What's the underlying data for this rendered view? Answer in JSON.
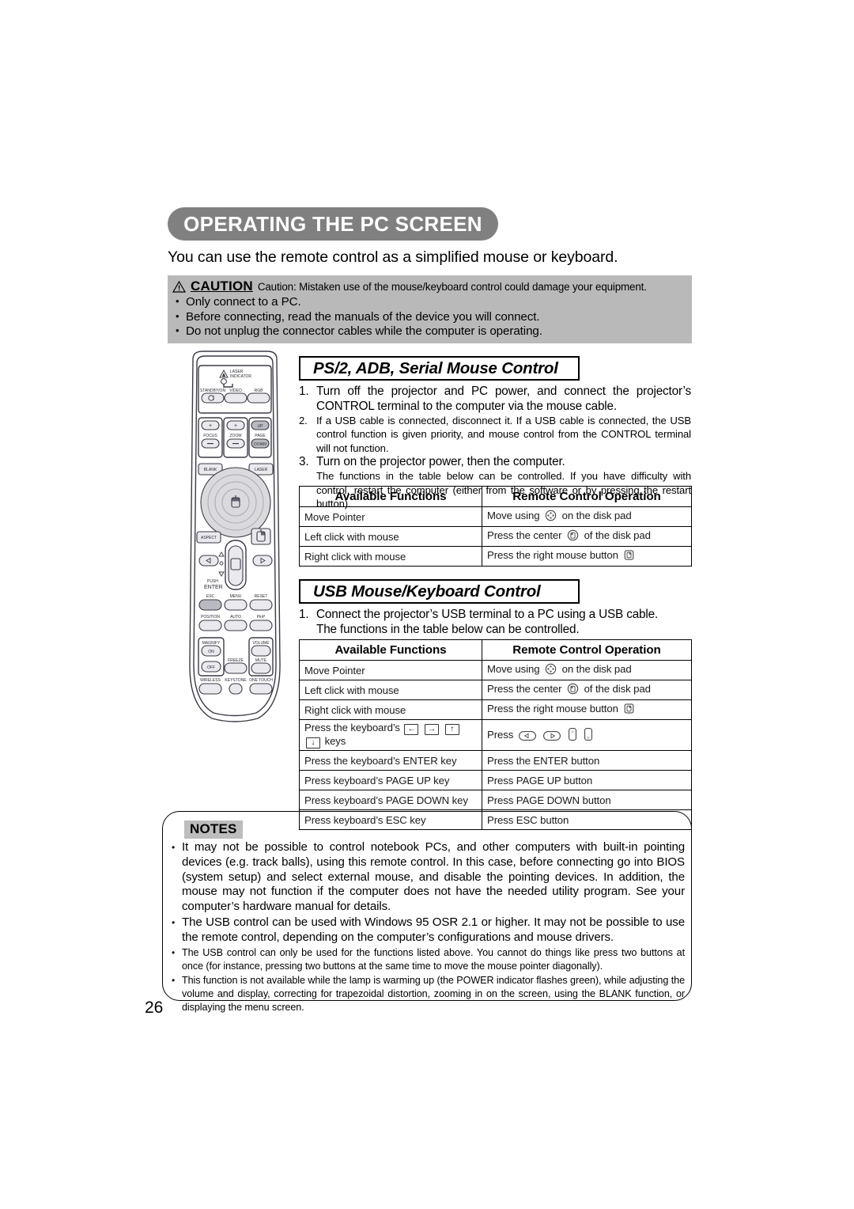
{
  "page": {
    "title": "OPERATING THE PC SCREEN",
    "intro": "You can use the remote control as a simplified mouse or keyboard.",
    "number": "26"
  },
  "caution": {
    "icon": "warning-triangle-icon",
    "word": "CAUTION",
    "text": "Caution: Mistaken use of the mouse/keyboard control could damage your equipment.",
    "bullets": [
      "Only connect to a PC.",
      "Before connecting, read the manuals of the device you will connect.",
      "Do not unplug the connector cables while the computer is operating."
    ]
  },
  "remote": {
    "caption": "remote-control-illustration",
    "buttons": [
      "LASER INDICATOR",
      "STANDBY/ON",
      "VIDEO",
      "RGB",
      "FOCUS",
      "ZOOM",
      "PAGE UP",
      "PAGE DOWN",
      "BLANK",
      "LASER",
      "ASPECT",
      "PUSH ENTER",
      "ESC",
      "MENU",
      "RESET",
      "POSITION",
      "AUTO",
      "PinP",
      "MAGNIFY ON",
      "MAGNIFY OFF",
      "FREEZE",
      "VOLUME",
      "MUTE",
      "WIRELESS",
      "KEYSTONE",
      "ONE TOUCH"
    ],
    "labels": {
      "laser": "LASER",
      "indicator": "INDICATOR",
      "standby_on": "STANDBY/ON",
      "video": "VIDEO",
      "rgb": "RGB",
      "focus": "FOCUS",
      "zoom": "ZOOM",
      "page": "PAGE",
      "up": "UP",
      "down": "DOWN",
      "blank": "BLANK",
      "laser_btn": "LASER",
      "aspect": "ASPECT",
      "push": "PUSH",
      "enter": "ENTER",
      "esc": "ESC",
      "menu": "MENU",
      "reset": "RESET",
      "position": "POSITION",
      "auto": "AUTO",
      "pinp": "PinP",
      "magnify": "MAGNIFY",
      "on": "ON",
      "off": "OFF",
      "freeze": "FREEZE",
      "volume": "VOLUME",
      "mute": "MUTE",
      "wireless": "WIRELESS",
      "keystone": "KEYSTONE",
      "one_touch": "ONE TOUCH",
      "plus": "+",
      "minus": "−"
    }
  },
  "ps2_section": {
    "heading": "PS/2, ADB, Serial Mouse Control",
    "steps": [
      {
        "num": "1.",
        "size": "lg",
        "text": "Turn off the projector and PC power, and connect the projector’s CONTROL terminal to the computer via the mouse cable."
      },
      {
        "num": "2.",
        "size": "sm",
        "text": "If a USB cable is connected, disconnect it. If a USB cable is connected, the USB control function is given priority, and mouse control from the CONTROL terminal will not function."
      },
      {
        "num": "3.",
        "size": "lg",
        "text": "Turn on the projector power, then the computer."
      },
      {
        "num": "",
        "size": "sm",
        "text": "The functions in the table below can be controlled. If you have difficulty with control, restart the computer (either from the software or by pressing the restart button)."
      }
    ],
    "table": {
      "headers": [
        "Available Functions",
        "Remote Control Operation"
      ],
      "rows": [
        {
          "fn": "Move Pointer",
          "op_pre": "Move using",
          "op_icon": "disk-pad-icon",
          "op_post": "on the disk pad"
        },
        {
          "fn": "Left click with mouse",
          "op_pre": "Press the center",
          "op_icon": "mouse-left-button-icon",
          "op_post": "of the disk pad"
        },
        {
          "fn": "Right click with mouse",
          "op_pre": "Press the right mouse button",
          "op_icon": "mouse-right-button-icon",
          "op_post": ""
        }
      ]
    }
  },
  "usb_section": {
    "heading": "USB Mouse/Keyboard Control",
    "steps": [
      {
        "num": "1.",
        "size": "lg",
        "text": "Connect the projector’s USB terminal to a PC using a USB cable."
      },
      {
        "num": "",
        "size": "lg",
        "text": "The functions in the table below can be controlled."
      }
    ],
    "table": {
      "headers": [
        "Available Functions",
        "Remote Control Operation"
      ],
      "rows": [
        {
          "fn": "Move Pointer",
          "op_pre": "Move using",
          "op_icon": "disk-pad-icon",
          "op_post": "on the disk pad"
        },
        {
          "fn": "Left click with mouse",
          "op_pre": "Press the center",
          "op_icon": "mouse-left-button-icon",
          "op_post": "of the disk pad"
        },
        {
          "fn": "Right click with mouse",
          "op_pre": "Press the right mouse button",
          "op_icon": "mouse-right-button-icon",
          "op_post": ""
        },
        {
          "fn_pre": "Press the keyboard’s",
          "fn_keys": [
            "←",
            "→",
            "↑",
            "↓"
          ],
          "fn_post": "keys",
          "op_pre": "Press",
          "op_icons": [
            "left-arrow-button-icon",
            "right-arrow-button-icon",
            "page-up-button-icon",
            "page-down-button-icon"
          ],
          "op_post": ""
        },
        {
          "fn": "Press the keyboard’s ENTER key",
          "op_pre": "Press the ENTER button",
          "op_post": ""
        },
        {
          "fn": "Press keyboard’s PAGE UP key",
          "op_pre": "Press PAGE UP button",
          "op_post": ""
        },
        {
          "fn": "Press keyboard’s PAGE DOWN key",
          "op_pre": "Press PAGE DOWN button",
          "op_post": ""
        },
        {
          "fn": "Press keyboard’s ESC key",
          "op_pre": "Press ESC button",
          "op_post": ""
        }
      ]
    }
  },
  "notes": {
    "label": "NOTES",
    "items": [
      {
        "size": "lg",
        "text": "It may not be possible to control notebook PCs, and other computers with built-in pointing devices (e.g. track balls), using this remote control. In this case, before connecting go into BIOS (system setup) and select external mouse, and disable the pointing devices. In addition, the mouse may not function if the computer does not have the needed utility program. See your computer’s hardware manual for details."
      },
      {
        "size": "lg",
        "text": "The USB control can be used with Windows 95 OSR 2.1 or higher. It may not be possible to use the remote control, depending on the computer’s configurations and mouse drivers."
      },
      {
        "size": "sm",
        "text": "The USB control can only be used for the functions listed above. You cannot do things like press two buttons at once (for instance, pressing two buttons at the same time to move the mouse pointer diagonally)."
      },
      {
        "size": "sm",
        "text": "This function is not available while the lamp is warming up (the POWER indicator flashes green), while adjusting the volume and display, correcting for trapezoidal distortion, zooming in on the screen, using the BLANK function, or displaying the menu screen."
      }
    ]
  },
  "colors": {
    "banner_gray": "#808080",
    "caution_gray": "#b9b9b9",
    "notes_label_gray": "#bdbdbd",
    "button_fill": "#d4d4d4",
    "remote_body": "#ffffff"
  }
}
